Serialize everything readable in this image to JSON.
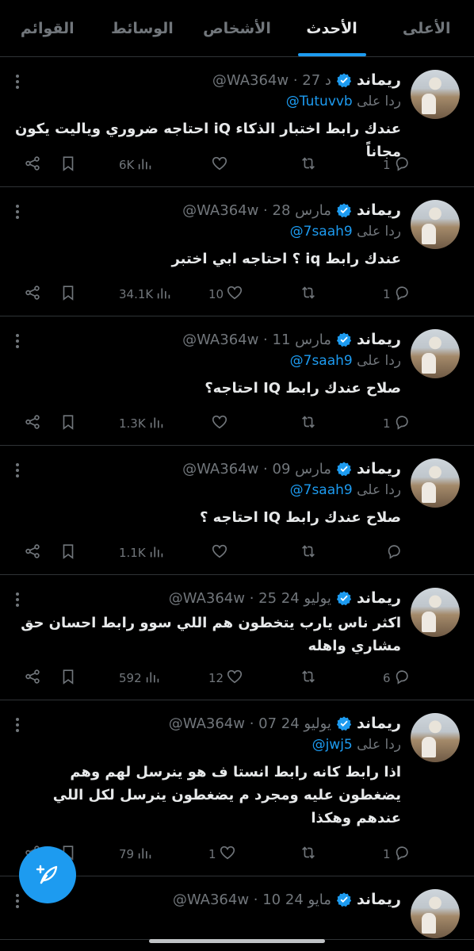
{
  "tabs": [
    {
      "label": "الأعلى",
      "active": false
    },
    {
      "label": "الأحدث",
      "active": true
    },
    {
      "label": "الأشخاص",
      "active": false
    },
    {
      "label": "الوسائط",
      "active": false
    },
    {
      "label": "القوائم",
      "active": false
    }
  ],
  "reply_prefix": "ردا على",
  "tweets": [
    {
      "name": "ريماند",
      "handle": "@WA364w",
      "date": "27 د",
      "reply_to": "@Tutuvvb",
      "text": "عندك رابط اختبار الذكاء iQ احتاجه ضروري وياليت يكون مجاناً",
      "replies": "1",
      "retweets": "",
      "likes": "",
      "views": "6K"
    },
    {
      "name": "ريماند",
      "handle": "@WA364w",
      "date": "28 مارس",
      "reply_to": "@7saah9",
      "text": "عندك رابط iq ؟ احتاجه ابي اختبر",
      "replies": "1",
      "retweets": "",
      "likes": "10",
      "views": "34.1K"
    },
    {
      "name": "ريماند",
      "handle": "@WA364w",
      "date": "11 مارس",
      "reply_to": "@7saah9",
      "text": "صلاح عندك رابط IQ احتاجه؟",
      "replies": "1",
      "retweets": "",
      "likes": "",
      "views": "1.3K"
    },
    {
      "name": "ريماند",
      "handle": "@WA364w",
      "date": "09 مارس",
      "reply_to": "@7saah9",
      "text": "صلاح عندك رابط IQ احتاجه ؟",
      "replies": "",
      "retweets": "",
      "likes": "",
      "views": "1.1K"
    },
    {
      "name": "ريماند",
      "handle": "@WA364w",
      "date": "25 يوليو 24",
      "reply_to": "",
      "text": "اكثر ناس يارب يتخطون هم اللي سوو رابط احسان حق مشاري واهله",
      "replies": "6",
      "retweets": "",
      "likes": "12",
      "views": "592"
    },
    {
      "name": "ريماند",
      "handle": "@WA364w",
      "date": "07 يوليو 24",
      "reply_to": "@jwj5",
      "text": "اذا رابط كانه رابط انستا ف هو ينرسل لهم وهم يضغطون عليه ومجرد م يضغطون ينرسل لكل اللي عندهم وهكذا",
      "replies": "1",
      "retweets": "",
      "likes": "1",
      "views": "79"
    },
    {
      "name": "ريماند",
      "handle": "@WA364w",
      "date": "10 مايو 24",
      "reply_to": "",
      "text": "",
      "replies": "",
      "retweets": "",
      "likes": "",
      "views": ""
    }
  ],
  "colors": {
    "accent": "#1d9bf0",
    "muted": "#71767b",
    "text": "#e7e9ea",
    "divider": "#2f3336"
  },
  "icons": [
    "share-icon",
    "bookmark-icon",
    "views-icon",
    "like-icon",
    "retweet-icon",
    "reply-icon",
    "verified-icon",
    "more-icon",
    "compose-icon"
  ]
}
